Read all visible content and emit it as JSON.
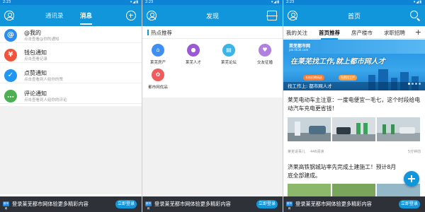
{
  "status": {
    "time": "2:23"
  },
  "messages_screen": {
    "tabs": [
      "通讯录",
      "消息"
    ],
    "items": [
      {
        "icon": "at-icon",
        "title": "@我的",
        "subtitle": "点击查看@你的通知",
        "color": "#2d8cf0"
      },
      {
        "icon": "wallet-icon",
        "title": "钱包通知",
        "subtitle": "点击查看记录",
        "color": "#f0533c"
      },
      {
        "icon": "thumbs-up-icon",
        "title": "点赞通知",
        "subtitle": "点击查看到人给你的赞",
        "color": "#2196f3"
      },
      {
        "icon": "comment-icon",
        "title": "评论通知",
        "subtitle": "点击查看到人给你的评论",
        "color": "#4caf50"
      }
    ]
  },
  "discover_screen": {
    "title": "发现",
    "section_title": "热点推荐",
    "items": [
      {
        "label": "莱芜房产",
        "icon": "house-icon",
        "color": "#3d8ef5"
      },
      {
        "label": "莱芜人才",
        "icon": "person-icon",
        "color": "#9b59d6"
      },
      {
        "label": "莱芜论坛",
        "icon": "forum-icon",
        "color": "#3bb4e8"
      },
      {
        "label": "交友征婚",
        "icon": "heart-icon",
        "color": "#b07fe0"
      },
      {
        "label": "都市网优品",
        "icon": "shop-icon",
        "color": "#f05b5b"
      }
    ]
  },
  "home_screen": {
    "title": "首页",
    "categories": [
      "我的关注",
      "首页推荐",
      "房产楼市",
      "求职招聘"
    ],
    "banner": {
      "logo": "莱芜都市网",
      "logo_sub": "job.0634.com",
      "headline": "在莱芜找工作,就上都市网人才",
      "tags": [
        "本地招聘精选",
        "免费找工作"
      ],
      "caption": "找工作上: 都市网人才"
    },
    "news": [
      {
        "title": "莱芜电动车主注意：一度电便宜一毛七，这个时段给电动汽车充电更省钱！",
        "source": "莱芜说事儿",
        "reads": "446阅读",
        "time": "5分钟前"
      },
      {
        "title": "济莱高铁钢城站率先完成土建施工！预计8月底全部建成。"
      }
    ]
  },
  "login_banner": {
    "logo": "都市网",
    "text": "登录莱芜都市网体验更多精彩内容",
    "button": "立即登录"
  }
}
